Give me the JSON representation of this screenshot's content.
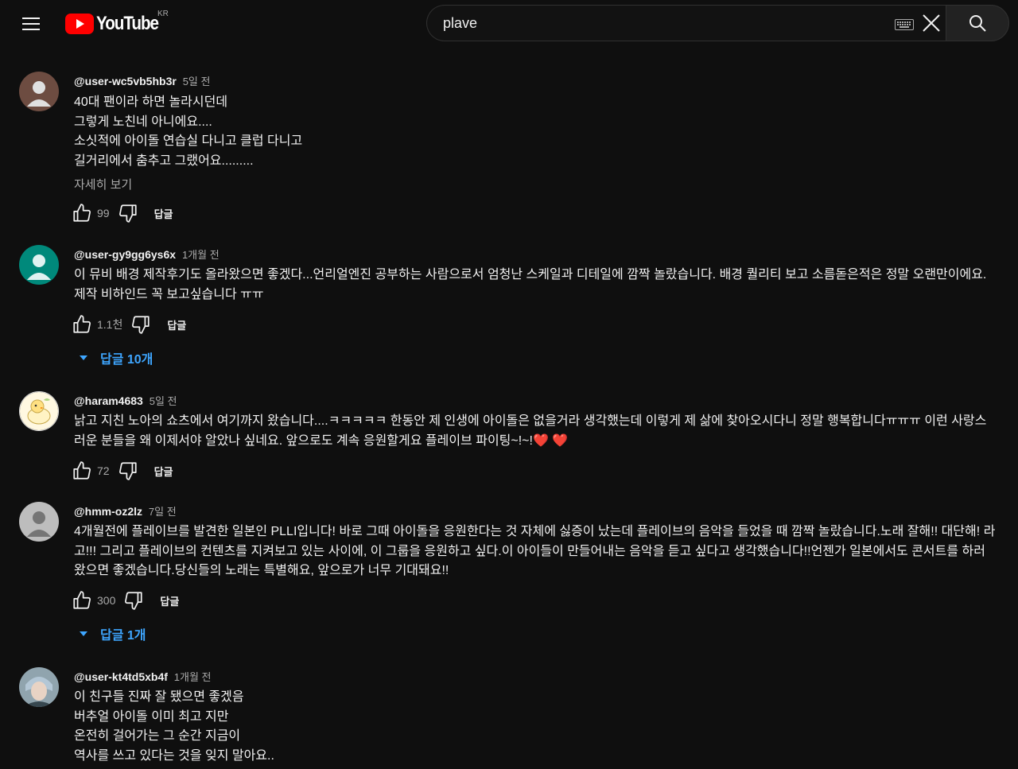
{
  "header": {
    "logo_text": "YouTube",
    "region": "KR",
    "search_value": "plave"
  },
  "comments": [
    {
      "author": "@user-wc5vb5hb3r",
      "time": "5일 전",
      "text": "40대 팬이라 하면 놀라시던데\n그렇게 노친네 아니에요....\n소싯적에 아이돌 연습실 다니고 클럽 다니고\n길거리에서 춤추고 그랬어요.........",
      "read_more": "자세히 보기",
      "likes": "99",
      "reply_label": "답글",
      "avatar_color": "#6d4c41"
    },
    {
      "author": "@user-gy9gg6ys6x",
      "time": "1개월 전",
      "text": "이 뮤비 배경 제작후기도 올라왔으면 좋겠다...언리얼엔진 공부하는 사람으로서 엄청난 스케일과 디테일에 깜짝 놀랐습니다. 배경 퀄리티 보고 소름돋은적은 정말 오랜만이에요.\n제작 비하인드 꼭 보고싶습니다 ㅠㅠ",
      "likes": "1.1천",
      "reply_label": "답글",
      "replies_label": "답글 10개",
      "avatar_color": "#00897b"
    },
    {
      "author": "@haram4683",
      "time": "5일 전",
      "text": "낡고 지친 노아의 쇼츠에서 여기까지 왔습니다....ㅋㅋㅋㅋㅋ 한동안 제 인생에 아이돌은 없을거라 생각했는데 이렇게 제 삶에 찾아오시다니 정말 행복합니다ㅠㅠㅠ 이런 사랑스러운 분들을 왜 이제서야 알았나 싶네요. 앞으로도 계속 응원할게요 플레이브 파이팅~!~!❤️ ❤️",
      "likes": "72",
      "reply_label": "답글",
      "avatar_color": "#fff8e1"
    },
    {
      "author": "@hmm-oz2lz",
      "time": "7일 전",
      "text": "4개월전에 플레이브를 발견한 일본인 PLLI입니다! 바로 그때 아이돌을 응원한다는 것 자체에 싫증이 났는데 플레이브의 음악을 들었을 때 깜짝 놀랐습니다.노래 잘해!! 대단해! 라고!!! 그리고 플레이브의 컨텐츠를 지켜보고 있는 사이에, 이 그룹을 응원하고 싶다.이 아이들이 만들어내는 음악을 듣고 싶다고 생각했습니다!!언젠가 일본에서도 콘서트를 하러 왔으면 좋겠습니다.당신들의 노래는 특별해요, 앞으로가 너무 기대돼요!!",
      "likes": "300",
      "reply_label": "답글",
      "replies_label": "답글 1개",
      "avatar_color": "#bdbdbd"
    },
    {
      "author": "@user-kt4td5xb4f",
      "time": "1개월 전",
      "text": "이 친구들 진짜 잘 됐으면 좋겠음\n버추얼 아이돌 이미 최고 지만\n온전히 걸어가는 그 순간 지금이\n역사를 쓰고 있다는 것을 잊지 말아요..",
      "avatar_color": "#90a4ae"
    }
  ],
  "colors": {
    "background": "#0f0f0f",
    "link_blue": "#3ea6ff",
    "secondary_text": "#aaaaaa",
    "logo_red": "#ff0000"
  }
}
